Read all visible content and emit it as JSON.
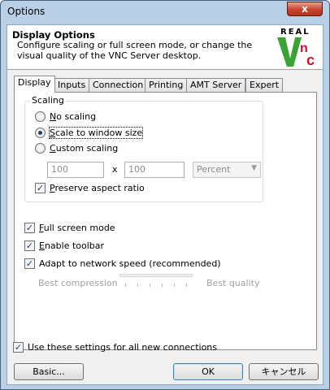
{
  "window": {
    "title": "Options",
    "close_label": "x"
  },
  "header": {
    "title": "Display Options",
    "description": "Configure scaling or full screen mode, or change the visual quality of the VNC Server desktop.",
    "logo_top": "REAL",
    "logo_brand": "VNC"
  },
  "tabs": [
    "Display",
    "Inputs",
    "Connection",
    "Printing",
    "AMT Server",
    "Expert"
  ],
  "scaling": {
    "group_label": "Scaling",
    "no_scaling": "No scaling",
    "scale_to_window": "Scale to window size",
    "custom_scaling": "Custom scaling",
    "width_value": "100",
    "times": "x",
    "height_value": "100",
    "unit": "Percent",
    "preserve_aspect": "Preserve aspect ratio",
    "selected": "scale_to_window"
  },
  "options": {
    "full_screen": "Full screen mode",
    "enable_toolbar": "Enable toolbar",
    "adapt_speed": "Adapt to network speed (recommended)"
  },
  "quality": {
    "left_label": "Best compression",
    "right_label": "Best quality"
  },
  "footer": {
    "use_settings": "Use these settings for all new connections",
    "basic": "Basic...",
    "ok": "OK",
    "cancel": "キャンセル"
  },
  "colors": {
    "vnc_red": "#c8102e",
    "vnc_green": "#3aa335",
    "title_bar": "#b8cfe6"
  },
  "icons": {
    "close": "close-icon",
    "check": "checkmark-icon",
    "radio": "radio-dot-icon"
  }
}
